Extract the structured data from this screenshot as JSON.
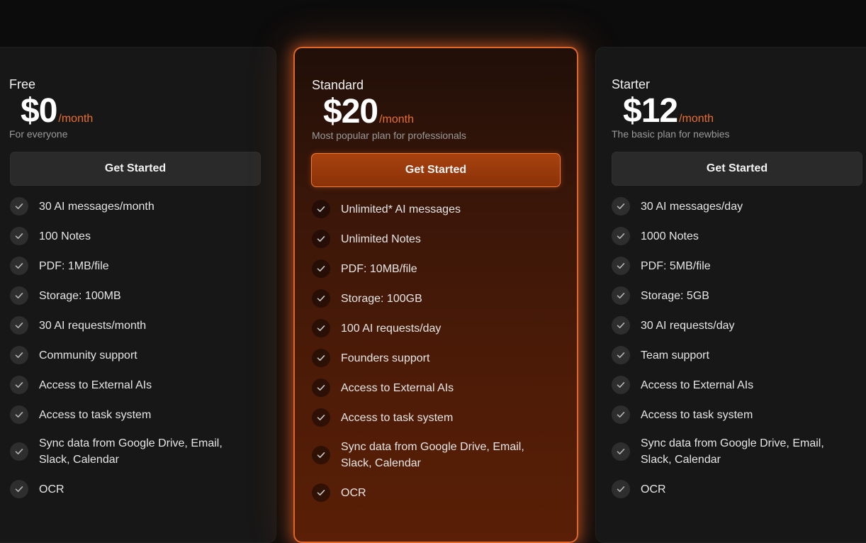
{
  "plans": [
    {
      "name": "Free",
      "price": "$0",
      "period": "/month",
      "tagline": "For everyone",
      "cta": "Get Started",
      "features": [
        "30 AI messages/month",
        "100 Notes",
        "PDF: 1MB/file",
        "Storage: 100MB",
        "30 AI requests/month",
        "Community support",
        "Access to External AIs",
        "Access to task system",
        "Sync data from Google Drive, Email, Slack, Calendar",
        "OCR"
      ]
    },
    {
      "name": "Standard",
      "price": "$20",
      "period": "/month",
      "tagline": "Most popular plan for professionals",
      "cta": "Get Started",
      "features": [
        "Unlimited* AI messages",
        "Unlimited Notes",
        "PDF: 10MB/file",
        "Storage: 100GB",
        "100 AI requests/day",
        "Founders support",
        "Access to External AIs",
        "Access to task system",
        "Sync data from Google Drive, Email, Slack, Calendar",
        "OCR"
      ]
    },
    {
      "name": "Starter",
      "price": "$12",
      "period": "/month",
      "tagline": "The basic plan for newbies",
      "cta": "Get Started",
      "features": [
        "30 AI messages/day",
        "1000 Notes",
        "PDF: 5MB/file",
        "Storage: 5GB",
        "30 AI requests/day",
        "Team support",
        "Access to External AIs",
        "Access to task system",
        "Sync data from Google Drive, Email, Slack, Calendar",
        "OCR"
      ]
    }
  ],
  "icons": {
    "feature_check": "check-icon"
  },
  "colors": {
    "page_background": "#0c0c0c",
    "card_background": "#171717",
    "accent": "#e8702f",
    "featured_border": "#e0662a",
    "button_background": "#2a2a2a"
  }
}
